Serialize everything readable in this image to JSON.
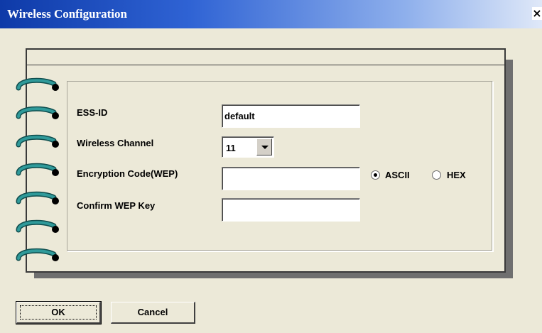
{
  "window": {
    "title": "Wireless Configuration",
    "close_glyph": "×"
  },
  "form": {
    "ess_id": {
      "label": "ESS-ID",
      "value": "default"
    },
    "wireless_channel": {
      "label": "Wireless Channel",
      "value": "11"
    },
    "encryption_code": {
      "label": "Encryption Code(WEP)",
      "value": ""
    },
    "confirm_wep_key": {
      "label": "Confirm WEP Key",
      "value": ""
    },
    "key_format": {
      "options": [
        {
          "label": "ASCII",
          "selected": true
        },
        {
          "label": "HEX",
          "selected": false
        }
      ]
    }
  },
  "buttons": {
    "ok_label": "OK",
    "cancel_label": "Cancel"
  },
  "colors": {
    "titlebar_start": "#0e3aa8",
    "titlebar_end": "#dfe8f8",
    "dialog_bg": "#ece9d8",
    "binder_ring": "#2a8a8a"
  },
  "icons": {
    "close": "close-icon",
    "dropdown": "chevron-down-icon",
    "binder_ring": "binder-ring-icon"
  }
}
